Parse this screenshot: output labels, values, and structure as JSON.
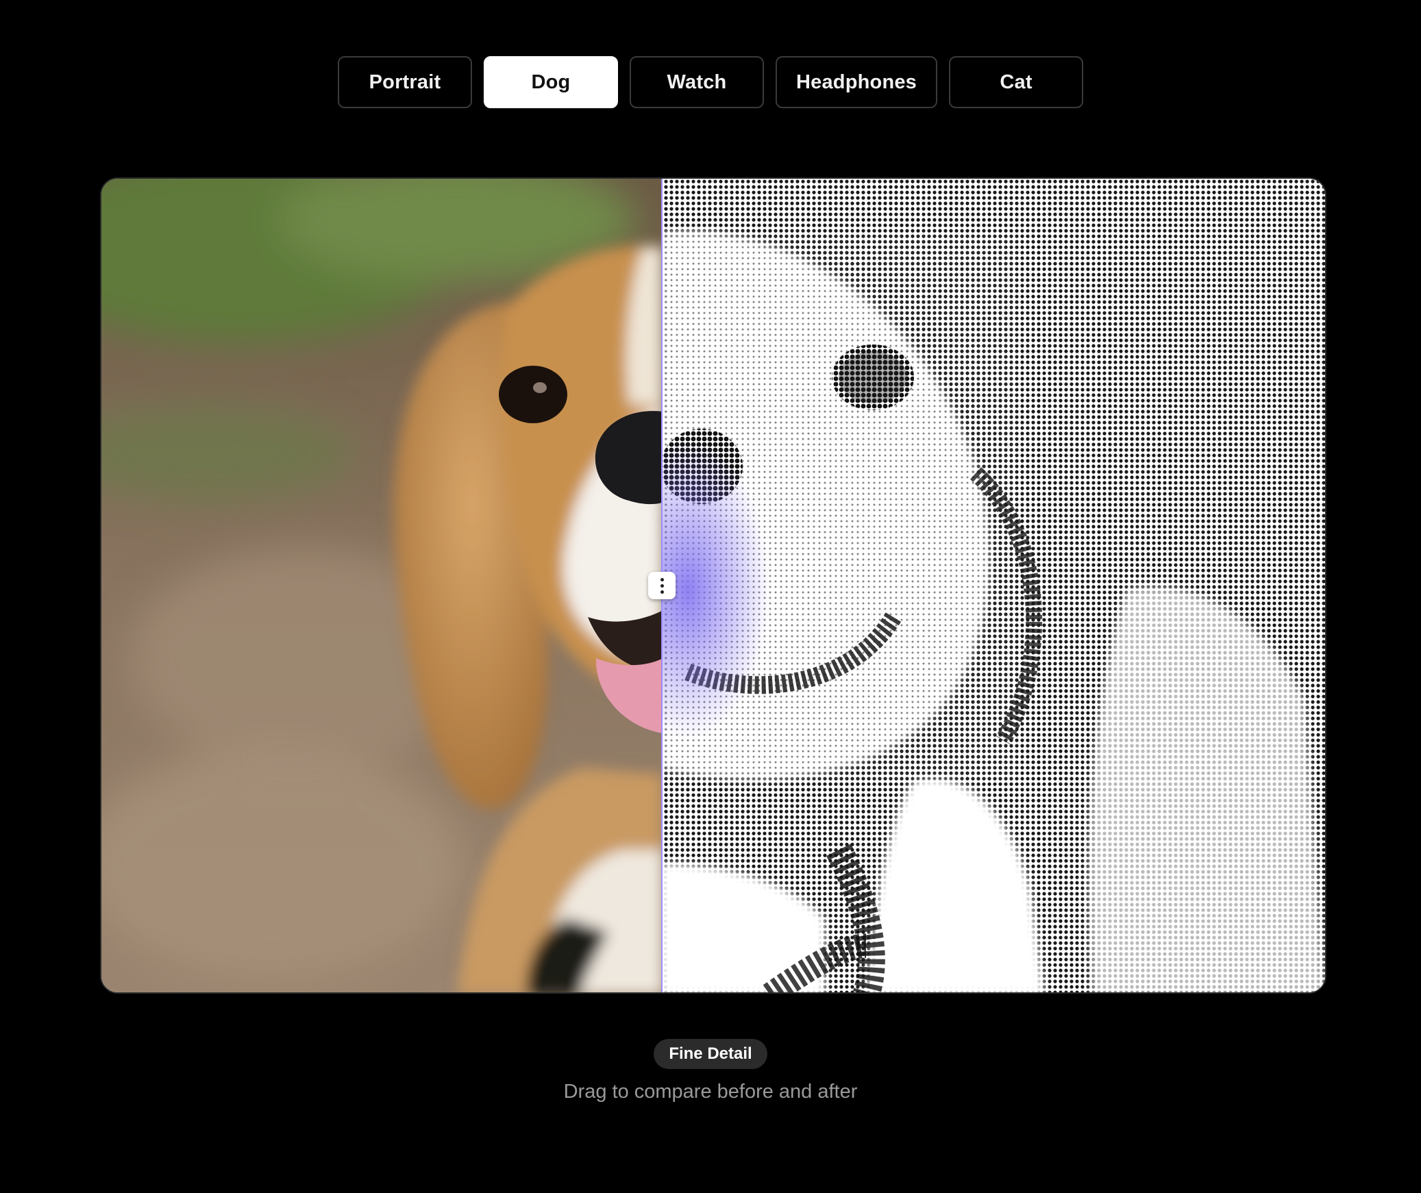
{
  "tabs": [
    {
      "label": "Portrait",
      "active": false
    },
    {
      "label": "Dog",
      "active": true
    },
    {
      "label": "Watch",
      "active": false
    },
    {
      "label": "Headphones",
      "active": false
    },
    {
      "label": "Cat",
      "active": false
    }
  ],
  "compare": {
    "slider_position": 0.458,
    "before_image": "beagle-photo",
    "after_image": "beagle-halftone",
    "handle_icon": "vertical-dots-icon"
  },
  "caption": {
    "badge": "Fine Detail",
    "hint": "Drag to compare before and after"
  },
  "colors": {
    "background": "#000000",
    "tab_active_bg": "#ffffff",
    "divider": "#9b8cff",
    "badge_bg": "#2b2b2b",
    "hint_text": "#9a9a9a"
  }
}
